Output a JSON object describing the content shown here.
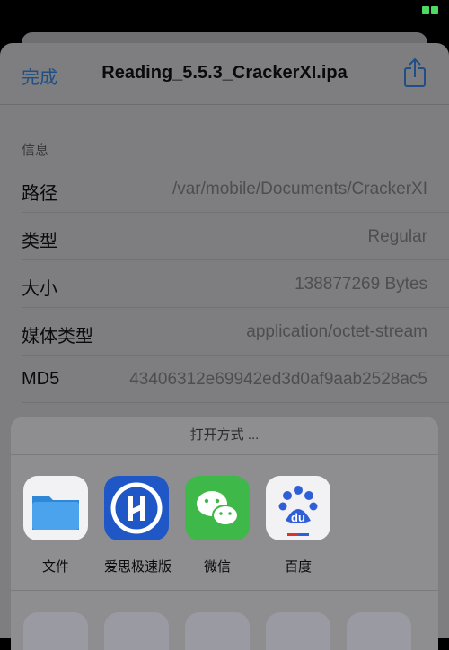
{
  "status": {
    "battery_color": "#4cd964"
  },
  "nav": {
    "done_label": "完成",
    "title": "Reading_5.5.3_CrackerXI.ipa",
    "share_icon": "share-icon"
  },
  "info": {
    "section_title": "信息",
    "rows": [
      {
        "label": "路径",
        "value": "/var/mobile/Documents/CrackerXI"
      },
      {
        "label": "类型",
        "value": "Regular"
      },
      {
        "label": "大小",
        "value": "138877269 Bytes"
      },
      {
        "label": "媒体类型",
        "value": "application/octet-stream"
      },
      {
        "label": "MD5",
        "value": "43406312e69942ed3d0af9aab2528ac5"
      }
    ]
  },
  "open_with": {
    "title": "打开方式 ...",
    "apps": [
      {
        "name": "文件",
        "icon": "folder-icon"
      },
      {
        "name": "爱思极速版",
        "icon": "aisi-icon"
      },
      {
        "name": "微信",
        "icon": "wechat-icon"
      },
      {
        "name": "百度",
        "icon": "baidu-icon"
      }
    ]
  }
}
